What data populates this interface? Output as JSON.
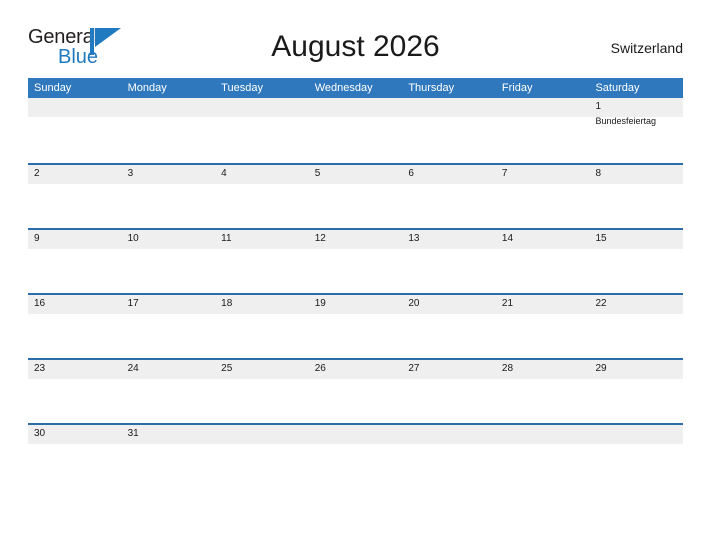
{
  "brand": {
    "name_part1": "General",
    "name_part2": "Blue",
    "flag_icon": "blue-flag-triangle",
    "accent_color": "#1f7ac0"
  },
  "header": {
    "title": "August 2026",
    "region": "Switzerland"
  },
  "theme": {
    "header_blue": "#2f78bd",
    "divider_blue": "#2b6cab",
    "band_gray": "#efefef",
    "text_dark": "#1a1a1a",
    "page_background": "#ffffff"
  },
  "calendar": {
    "weekdays": [
      "Sunday",
      "Monday",
      "Tuesday",
      "Wednesday",
      "Thursday",
      "Friday",
      "Saturday"
    ],
    "weeks": [
      [
        {
          "day": "",
          "event": ""
        },
        {
          "day": "",
          "event": ""
        },
        {
          "day": "",
          "event": ""
        },
        {
          "day": "",
          "event": ""
        },
        {
          "day": "",
          "event": ""
        },
        {
          "day": "",
          "event": ""
        },
        {
          "day": "1",
          "event": "Bundesfeiertag"
        }
      ],
      [
        {
          "day": "2",
          "event": ""
        },
        {
          "day": "3",
          "event": ""
        },
        {
          "day": "4",
          "event": ""
        },
        {
          "day": "5",
          "event": ""
        },
        {
          "day": "6",
          "event": ""
        },
        {
          "day": "7",
          "event": ""
        },
        {
          "day": "8",
          "event": ""
        }
      ],
      [
        {
          "day": "9",
          "event": ""
        },
        {
          "day": "10",
          "event": ""
        },
        {
          "day": "11",
          "event": ""
        },
        {
          "day": "12",
          "event": ""
        },
        {
          "day": "13",
          "event": ""
        },
        {
          "day": "14",
          "event": ""
        },
        {
          "day": "15",
          "event": ""
        }
      ],
      [
        {
          "day": "16",
          "event": ""
        },
        {
          "day": "17",
          "event": ""
        },
        {
          "day": "18",
          "event": ""
        },
        {
          "day": "19",
          "event": ""
        },
        {
          "day": "20",
          "event": ""
        },
        {
          "day": "21",
          "event": ""
        },
        {
          "day": "22",
          "event": ""
        }
      ],
      [
        {
          "day": "23",
          "event": ""
        },
        {
          "day": "24",
          "event": ""
        },
        {
          "day": "25",
          "event": ""
        },
        {
          "day": "26",
          "event": ""
        },
        {
          "day": "27",
          "event": ""
        },
        {
          "day": "28",
          "event": ""
        },
        {
          "day": "29",
          "event": ""
        }
      ],
      [
        {
          "day": "30",
          "event": ""
        },
        {
          "day": "31",
          "event": ""
        },
        {
          "day": "",
          "event": ""
        },
        {
          "day": "",
          "event": ""
        },
        {
          "day": "",
          "event": ""
        },
        {
          "day": "",
          "event": ""
        },
        {
          "day": "",
          "event": ""
        }
      ]
    ]
  }
}
